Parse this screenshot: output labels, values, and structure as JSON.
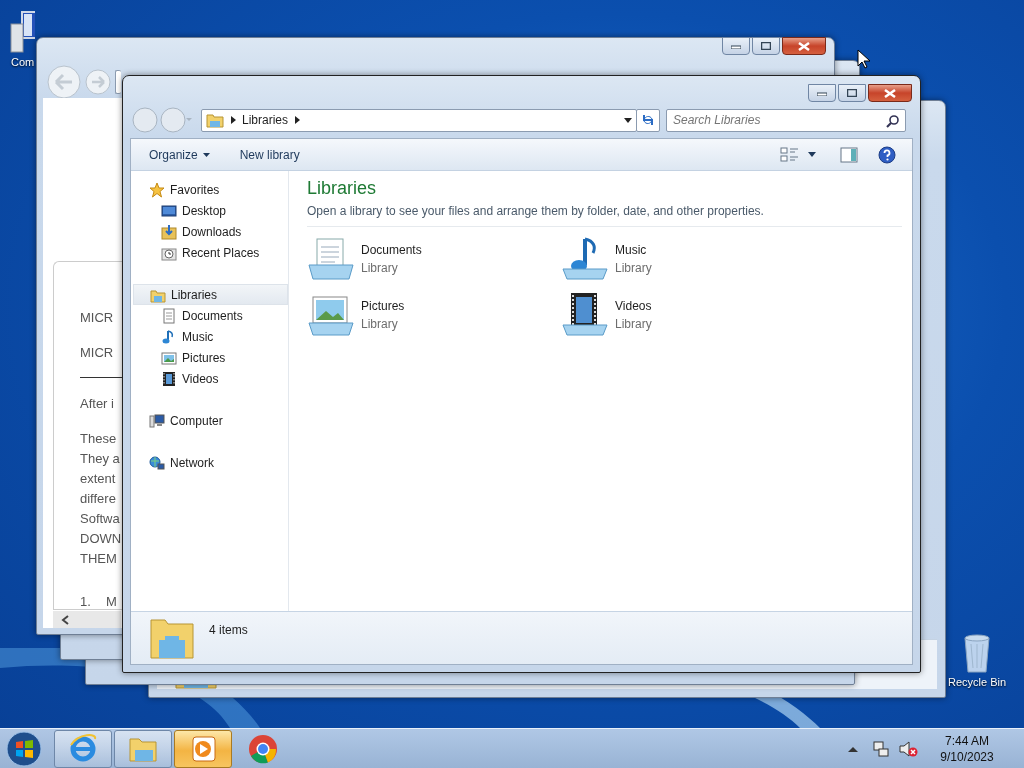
{
  "desktop_icons": [
    {
      "label": "Com",
      "kind": "computer"
    },
    {
      "label": "Recycle Bin",
      "kind": "recycle"
    }
  ],
  "document_window": {
    "lines": [
      "MICR",
      "MICR",
      "After i",
      "These",
      "They a",
      "extent",
      "differe",
      "Softwa",
      "DOWN",
      "THEM",
      "1.",
      "M"
    ]
  },
  "explorer": {
    "address": {
      "crumbs": [
        "Libraries"
      ]
    },
    "search": {
      "placeholder": "Search Libraries"
    },
    "toolbar": [
      "Organize",
      "New library"
    ],
    "nav_pane": [
      {
        "label": "Favorites",
        "kind": "favorites",
        "selected": false,
        "children": [
          {
            "label": "Desktop",
            "kind": "desktop",
            "selected": false
          },
          {
            "label": "Downloads",
            "kind": "downloads",
            "selected": false
          },
          {
            "label": "Recent Places",
            "kind": "recent",
            "selected": false
          }
        ]
      },
      {
        "label": "Libraries",
        "kind": "library",
        "selected": true,
        "children": [
          {
            "label": "Documents",
            "kind": "documents",
            "selected": false
          },
          {
            "label": "Music",
            "kind": "music",
            "selected": false
          },
          {
            "label": "Pictures",
            "kind": "pictures",
            "selected": false
          },
          {
            "label": "Videos",
            "kind": "videos",
            "selected": false
          }
        ]
      },
      {
        "label": "Computer",
        "kind": "computer",
        "selected": false
      },
      {
        "label": "Network",
        "kind": "network",
        "selected": false
      }
    ],
    "title": "Libraries",
    "description": "Open a library to see your files and arrange them by folder, date, and other properties.",
    "items": [
      {
        "name": "Documents",
        "type": "Library",
        "kind": "documents"
      },
      {
        "name": "Music",
        "type": "Library",
        "kind": "music"
      },
      {
        "name": "Pictures",
        "type": "Library",
        "kind": "pictures"
      },
      {
        "name": "Videos",
        "type": "Library",
        "kind": "videos"
      }
    ],
    "details": {
      "count": "4 items"
    }
  },
  "taskbar": {
    "apps": [
      {
        "kind": "ie",
        "running": true,
        "selected": false
      },
      {
        "kind": "explorer",
        "running": true,
        "selected": false
      },
      {
        "kind": "media",
        "running": true,
        "selected": true
      },
      {
        "kind": "chrome",
        "running": false,
        "selected": false
      }
    ],
    "tray": {
      "volume_muted": true
    },
    "time": "7:44 AM",
    "date": "9/10/2023"
  }
}
